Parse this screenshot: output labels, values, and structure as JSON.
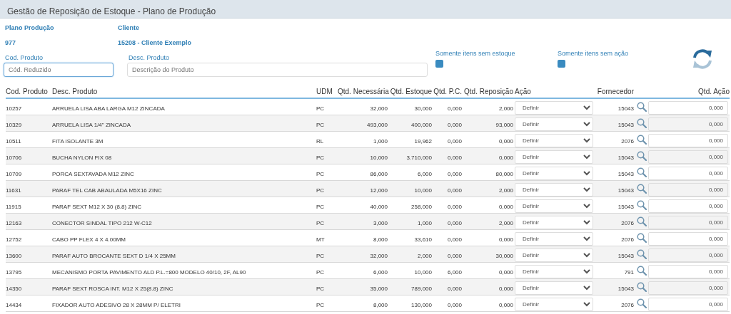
{
  "title": "Gestão de Reposição de Estoque - Plano de Produção",
  "info": [
    {
      "label": "Plano Produção",
      "value": "977"
    },
    {
      "label": "Cliente",
      "value": "15208 - Cliente Exemplo"
    }
  ],
  "filters": {
    "fields": [
      {
        "label": "Cod. Produto",
        "placeholder": "Cód. Reduzido",
        "focused": true
      },
      {
        "label": "Desc. Produto",
        "placeholder": "Descrição do Produto",
        "focused": false
      }
    ],
    "checkboxes": [
      {
        "label": "Somente itens sem estoque",
        "checked": false
      },
      {
        "label": "Somente itens sem ação",
        "checked": false
      }
    ]
  },
  "table": {
    "columns": [
      "Cod. Produto",
      "Desc. Produto",
      "UDM",
      "Qtd. Necessária",
      "Qtd. Estoque",
      "Qtd. P.C.",
      "Qtd. Reposição",
      "Ação",
      "Fornecedor",
      "Qtd. Ação"
    ],
    "rows": [
      {
        "cells": [
          "10257",
          "ARRUELA LISA ABA LARGA M12 ZINCADA",
          "PC",
          "32,000",
          "30,000",
          "0,000",
          "2,000"
        ],
        "action": "Definir",
        "supplier": "15043",
        "qty": "0,000"
      },
      {
        "cells": [
          "10329",
          "ARRUELA LISA 1/4\" ZINCADA",
          "PC",
          "493,000",
          "400,000",
          "0,000",
          "93,000"
        ],
        "action": "Definir",
        "supplier": "15043",
        "qty": "0,000"
      },
      {
        "cells": [
          "10511",
          "FITA ISOLANTE 3M",
          "RL",
          "1,000",
          "19,962",
          "0,000",
          "0,000"
        ],
        "action": "Definir",
        "supplier": "2076",
        "qty": "0,000"
      },
      {
        "cells": [
          "10706",
          "BUCHA NYLON FIX 08",
          "PC",
          "10,000",
          "3.710,000",
          "0,000",
          "0,000"
        ],
        "action": "Definir",
        "supplier": "15043",
        "qty": "0,000"
      },
      {
        "cells": [
          "10709",
          "PORCA SEXTAVADA M12 ZINC",
          "PC",
          "86,000",
          "6,000",
          "0,000",
          "80,000"
        ],
        "action": "Definir",
        "supplier": "15043",
        "qty": "0,000"
      },
      {
        "cells": [
          "11631",
          "PARAF TEL CAB ABAULADA M5X16 ZINC",
          "PC",
          "12,000",
          "10,000",
          "0,000",
          "2,000"
        ],
        "action": "Definir",
        "supplier": "15043",
        "qty": "0,000"
      },
      {
        "cells": [
          "11915",
          "PARAF SEXT M12 X 30 (8.8) ZINC",
          "PC",
          "40,000",
          "258,000",
          "0,000",
          "0,000"
        ],
        "action": "Definir",
        "supplier": "15043",
        "qty": "0,000"
      },
      {
        "cells": [
          "12163",
          "CONECTOR SINDAL TIPO 212 W-C12",
          "PC",
          "3,000",
          "1,000",
          "0,000",
          "2,000"
        ],
        "action": "Definir",
        "supplier": "2076",
        "qty": "0,000"
      },
      {
        "cells": [
          "12752",
          "CABO PP FLEX 4 X 4.00MM",
          "MT",
          "8,000",
          "33,610",
          "0,000",
          "0,000"
        ],
        "action": "Definir",
        "supplier": "2076",
        "qty": "0,000"
      },
      {
        "cells": [
          "13600",
          "PARAF AUTO BROCANTE SEXT D 1/4 X 25MM",
          "PC",
          "32,000",
          "2,000",
          "0,000",
          "30,000"
        ],
        "action": "Definir",
        "supplier": "15043",
        "qty": "0,000"
      },
      {
        "cells": [
          "13795",
          "MECANISMO PORTA PAVIMENTO ALD P.L.=800 MODELO 40/10, 2F, AL90",
          "PC",
          "6,000",
          "10,000",
          "6,000",
          "0,000"
        ],
        "action": "Definir",
        "supplier": "791",
        "qty": "0,000"
      },
      {
        "cells": [
          "14350",
          "PARAF SEXT ROSCA INT. M12 X 25(8.8) ZINC",
          "PC",
          "35,000",
          "789,000",
          "0,000",
          "0,000"
        ],
        "action": "Definir",
        "supplier": "15043",
        "qty": "0,000"
      },
      {
        "cells": [
          "14434",
          "FIXADOR AUTO ADESIVO 28 X 28MM P/ ELETRI",
          "PC",
          "8,000",
          "130,000",
          "0,000",
          "0,000"
        ],
        "action": "Definir",
        "supplier": "2076",
        "qty": "0,000"
      }
    ]
  }
}
